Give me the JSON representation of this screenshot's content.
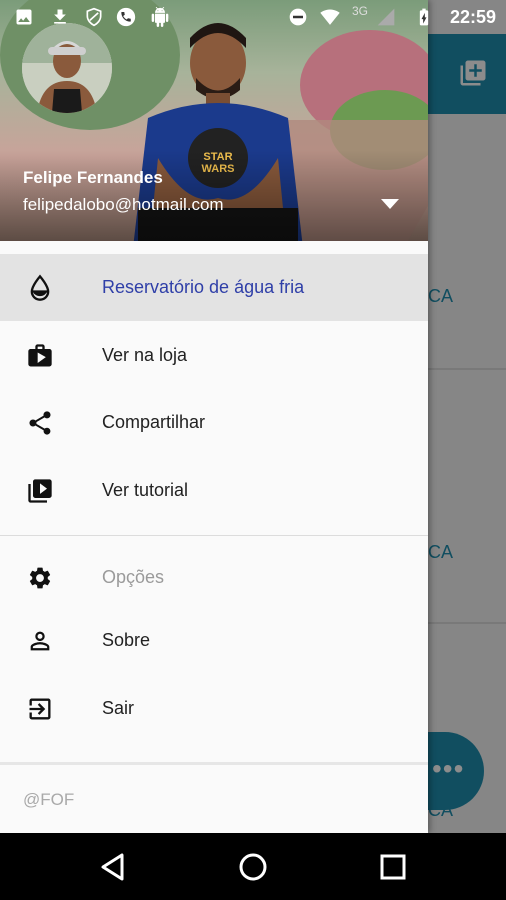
{
  "status_bar": {
    "time": "22:59",
    "network": "3G"
  },
  "background_app": {
    "card_text_1": "CA",
    "card_text_2": "CA",
    "card_text_3": "CA",
    "accent_color": "#1f8fb0"
  },
  "drawer": {
    "user_name": "Felipe Fernandes",
    "user_email": "felipedalobo@hotmail.com",
    "items": [
      {
        "label": "Reservatório de água fria",
        "icon": "water-drop-icon",
        "state": "active"
      },
      {
        "label": "Ver na loja",
        "icon": "store-icon",
        "state": "normal"
      },
      {
        "label": "Compartilhar",
        "icon": "share-icon",
        "state": "normal"
      },
      {
        "label": "Ver tutorial",
        "icon": "video-library-icon",
        "state": "normal"
      },
      {
        "label": "Opções",
        "icon": "gear-icon",
        "state": "disabled"
      },
      {
        "label": "Sobre",
        "icon": "person-icon",
        "state": "normal"
      },
      {
        "label": "Sair",
        "icon": "exit-icon",
        "state": "normal"
      }
    ],
    "footer": "@FOF",
    "active_color": "#2f3fa8"
  }
}
